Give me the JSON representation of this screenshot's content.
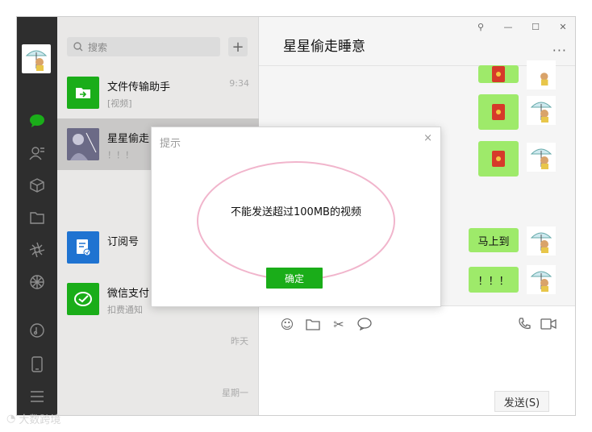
{
  "window": {
    "title": "星星偷走睡意",
    "controls": [
      "pin-icon",
      "minimize-icon",
      "maximize-icon",
      "close-icon"
    ]
  },
  "sidebar": {
    "icons": [
      "chat-icon",
      "contacts-icon",
      "favorites-icon",
      "files-icon",
      "moments-icon",
      "channels-icon",
      "music-icon",
      "phone-icon",
      "menu-icon"
    ]
  },
  "search": {
    "placeholder": "搜索"
  },
  "chats": [
    {
      "name": "文件传输助手",
      "preview": "[视频]",
      "time": "9:34",
      "color": "#1aad19"
    },
    {
      "name": "星星偷走",
      "preview": "！！！",
      "time": ""
    },
    {
      "name": "订阅号",
      "preview": "",
      "time": "",
      "color": "#1f73d1"
    },
    {
      "name": "微信支付",
      "preview": "扣费通知",
      "time": "",
      "color": "#1aad19"
    }
  ],
  "list_times": [
    "昨天",
    "星期一"
  ],
  "messages": [
    {
      "type": "redpacket"
    },
    {
      "type": "redpacket"
    },
    {
      "type": "redpacket"
    },
    {
      "type": "text",
      "text": "马上到"
    },
    {
      "type": "text",
      "text": "！！！"
    }
  ],
  "composer": {
    "tools": [
      "emoji-icon",
      "folder-icon",
      "scissors-icon",
      "chat-bubble-icon"
    ],
    "right_tools": [
      "phone-call-icon",
      "video-call-icon"
    ],
    "send_label": "发送(S)"
  },
  "dialog": {
    "title": "提示",
    "message": "不能发送超过100MB的视频",
    "ok_label": "确定",
    "close_glyph": "×"
  },
  "watermark": {
    "text": "大数跨境"
  },
  "colors": {
    "accent": "#1aad19",
    "bubble": "#9eea6a",
    "sidebar": "#2e2e2e",
    "highlight": "#f1b5cc"
  }
}
